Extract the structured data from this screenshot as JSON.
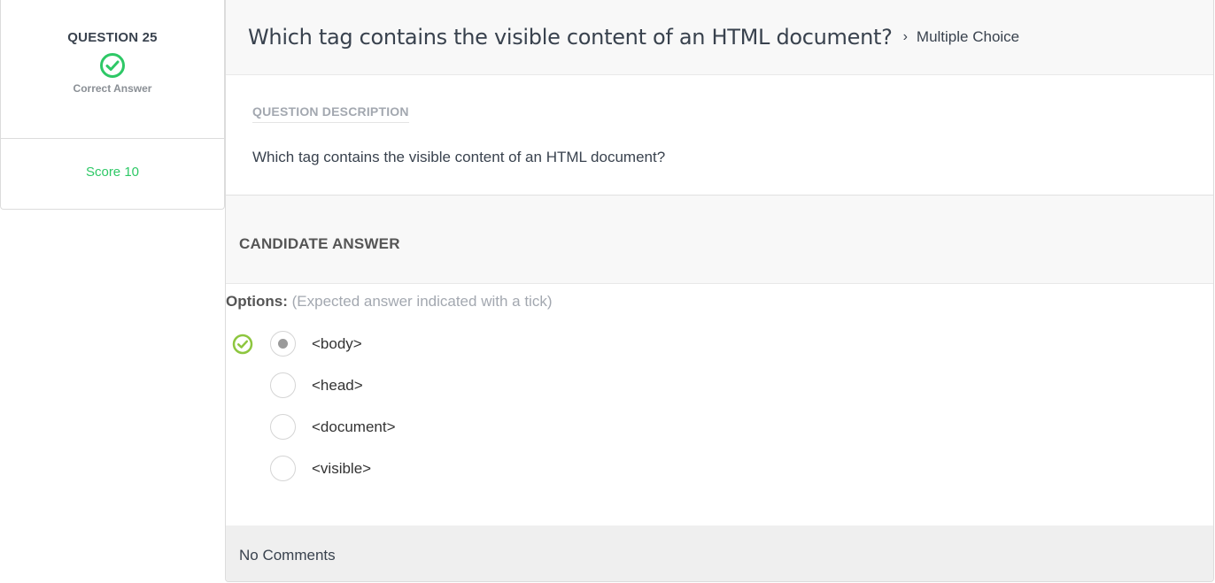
{
  "question": {
    "number_label": "QUESTION 25",
    "status_text": "Correct Answer",
    "status_icon": "check-circle-icon",
    "status_color": "#2ec866",
    "score_text": "Score 10"
  },
  "header": {
    "title": "Which tag contains the visible content of an HTML document?",
    "separator": "›",
    "type": "Multiple Choice"
  },
  "description": {
    "label": "QUESTION DESCRIPTION",
    "text": "Which tag contains the visible content of an HTML document?"
  },
  "candidate": {
    "title": "CANDIDATE ANSWER",
    "options_label": "Options:",
    "options_hint": "(Expected answer indicated with a tick)",
    "options": [
      {
        "label": "<body>",
        "selected": true,
        "expected": true
      },
      {
        "label": "<head>",
        "selected": false,
        "expected": false
      },
      {
        "label": "<document>",
        "selected": false,
        "expected": false
      },
      {
        "label": "<visible>",
        "selected": false,
        "expected": false
      }
    ],
    "tick_color": "#8dc63f"
  },
  "comments": {
    "text": "No Comments"
  }
}
